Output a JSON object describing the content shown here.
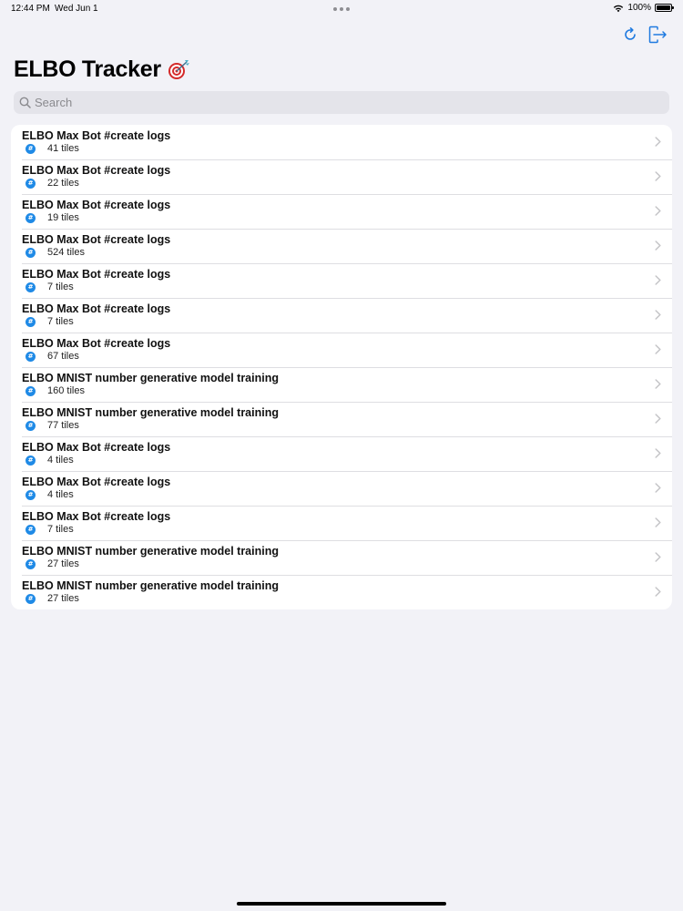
{
  "status_bar": {
    "time": "12:44 PM",
    "date": "Wed Jun 1",
    "battery": "100%"
  },
  "toolbar": {
    "refresh_icon": "refresh-icon",
    "logout_icon": "logout-icon"
  },
  "title": {
    "text": "ELBO Tracker",
    "emoji_icon": "target-icon"
  },
  "search": {
    "placeholder": "Search",
    "value": ""
  },
  "colors": {
    "background": "#f2f2f7",
    "accent": "#1f8ae6",
    "tag_icon": "#1f8ae6"
  },
  "list": {
    "items": [
      {
        "title": "ELBO Max Bot #create logs",
        "tiles": "41 tiles"
      },
      {
        "title": "ELBO Max Bot #create logs",
        "tiles": "22 tiles"
      },
      {
        "title": "ELBO Max Bot #create logs",
        "tiles": "19 tiles"
      },
      {
        "title": "ELBO Max Bot #create logs",
        "tiles": "524 tiles"
      },
      {
        "title": "ELBO Max Bot #create logs",
        "tiles": "7 tiles"
      },
      {
        "title": "ELBO Max Bot #create logs",
        "tiles": "7 tiles"
      },
      {
        "title": "ELBO Max Bot #create logs",
        "tiles": "67 tiles"
      },
      {
        "title": "ELBO MNIST number generative model training",
        "tiles": "160 tiles"
      },
      {
        "title": "ELBO MNIST number generative model training",
        "tiles": "77 tiles"
      },
      {
        "title": "ELBO Max Bot #create logs",
        "tiles": "4 tiles"
      },
      {
        "title": "ELBO Max Bot #create logs",
        "tiles": "4 tiles"
      },
      {
        "title": "ELBO Max Bot #create logs",
        "tiles": "7 tiles"
      },
      {
        "title": "ELBO MNIST number generative model training",
        "tiles": "27 tiles"
      },
      {
        "title": "ELBO MNIST number generative model training",
        "tiles": "27 tiles"
      }
    ]
  }
}
